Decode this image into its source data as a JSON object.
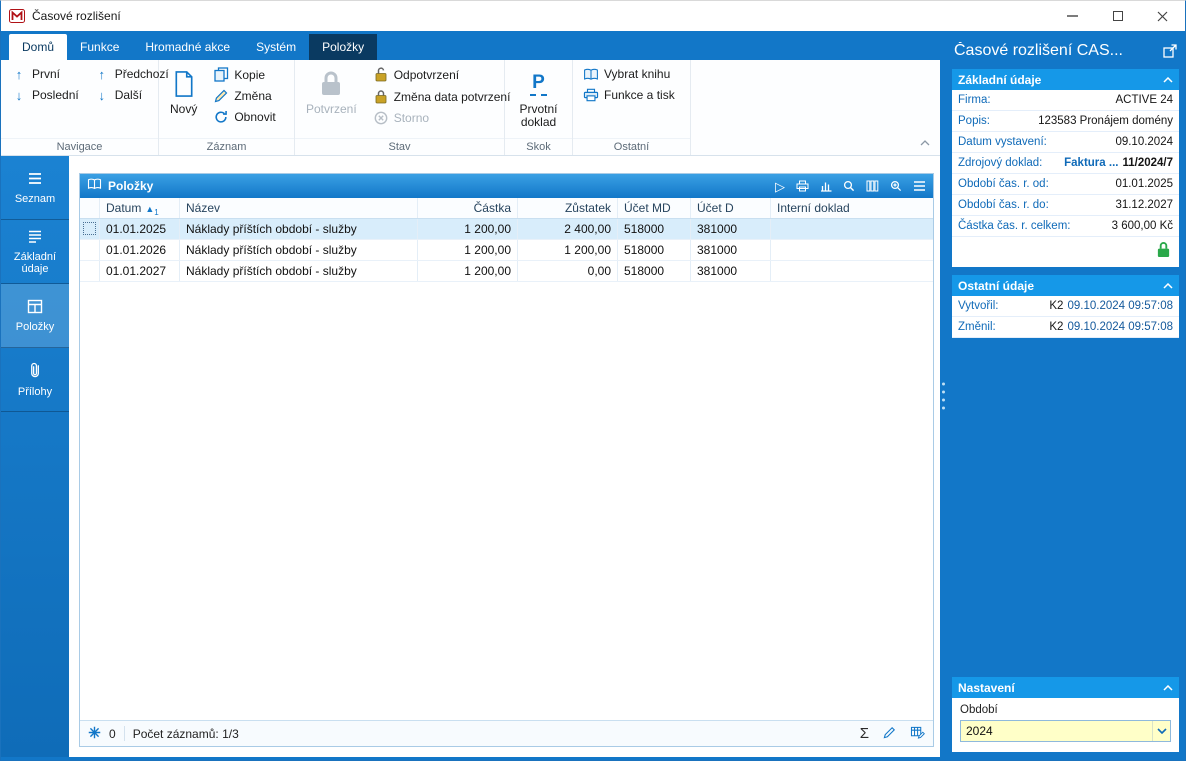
{
  "colors": {
    "accent_blue": "#1277c8",
    "contextual_tab_blue": "#0a3a61",
    "section_header_blue": "#1598e8",
    "selected_row_blue": "#d8edfb",
    "edit_field_yellow": "#ffffc8",
    "lock_green": "#2aa84a"
  },
  "icons": {
    "arrow_up": "↑",
    "arrow_down": "↓",
    "sigma": "Σ",
    "primary_doc_letter": "P",
    "play": "▷"
  },
  "window": {
    "title": "Časové rozlišení"
  },
  "ribbon": {
    "tabs": [
      {
        "label": "Domů"
      },
      {
        "label": "Funkce"
      },
      {
        "label": "Hromadné akce"
      },
      {
        "label": "Systém"
      },
      {
        "label": "Položky"
      }
    ],
    "navigace": {
      "label": "Navigace",
      "first": "První",
      "last": "Poslední",
      "prev": "Předchozí",
      "next": "Další"
    },
    "zaznam": {
      "label": "Záznam",
      "new": "Nový",
      "copy": "Kopie",
      "change": "Změna",
      "refresh": "Obnovit"
    },
    "stav": {
      "label": "Stav",
      "confirm": "Potvrzení",
      "unconfirm": "Odpotvrzení",
      "change_date": "Změna data potvrzení",
      "cancel": "Storno"
    },
    "skok": {
      "label": "Skok",
      "primary_doc": "Prvotní doklad"
    },
    "ostatni": {
      "label": "Ostatní",
      "select_book": "Vybrat knihu",
      "functions_print": "Funkce a tisk"
    }
  },
  "sidebar": {
    "items": [
      {
        "label": "Seznam"
      },
      {
        "label": "Základní údaje"
      },
      {
        "label": "Položky",
        "active": true
      },
      {
        "label": "Přílohy"
      }
    ]
  },
  "panel": {
    "title": "Položky"
  },
  "table": {
    "headers": [
      "Datum",
      "Název",
      "Částka",
      "Zůstatek",
      "Účet MD",
      "Účet D",
      "Interní doklad"
    ],
    "sort": {
      "glyph": "▲",
      "order": "1"
    },
    "rows": [
      [
        "01.01.2025",
        "Náklady příštích období - služby",
        "1 200,00",
        "2 400,00",
        "518000",
        "381000",
        ""
      ],
      [
        "01.01.2026",
        "Náklady příštích období - služby",
        "1 200,00",
        "1 200,00",
        "518000",
        "381000",
        ""
      ],
      [
        "01.01.2027",
        "Náklady příštích období - služby",
        "1 200,00",
        "0,00",
        "518000",
        "381000",
        ""
      ]
    ]
  },
  "statusbar": {
    "flag_count": "0",
    "records": "Počet záznamů: 1/3"
  },
  "right_panel": {
    "title": "Časové rozlišení CAS...",
    "zakladni": {
      "header": "Základní údaje",
      "fields": [
        {
          "label": "Firma:",
          "value": "ACTIVE 24"
        },
        {
          "label": "Popis:",
          "value": "123583 Pronájem domény"
        },
        {
          "label": "Datum vystavení:",
          "value": "09.10.2024"
        },
        {
          "label": "Zdrojový doklad:",
          "link": "Faktura ...",
          "value": "11/2024/7"
        },
        {
          "label": "Období čas. r. od:",
          "value": "01.01.2025"
        },
        {
          "label": "Období čas. r. do:",
          "value": "31.12.2027"
        },
        {
          "label": "Částka čas. r. celkem:",
          "value": "3 600,00 Kč"
        }
      ]
    },
    "ostatni": {
      "header": "Ostatní údaje",
      "fields": [
        {
          "label": "Vytvořil:",
          "user": "K2",
          "datetime": "09.10.2024 09:57:08"
        },
        {
          "label": "Změnil:",
          "user": "K2",
          "datetime": "09.10.2024 09:57:08"
        }
      ]
    },
    "nastaveni": {
      "header": "Nastavení",
      "field_label": "Období",
      "value": "2024"
    }
  }
}
